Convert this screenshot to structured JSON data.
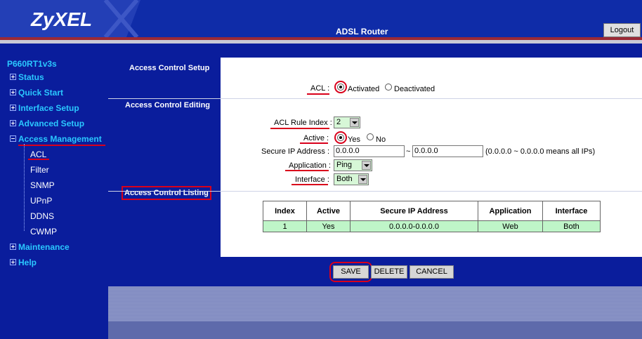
{
  "header": {
    "logo": "ZyXEL",
    "title": "ADSL Router",
    "logout_label": "Logout"
  },
  "sidebar": {
    "model": "P660RT1v3s",
    "items": [
      {
        "label": "Status",
        "expanded": false
      },
      {
        "label": "Quick Start",
        "expanded": false
      },
      {
        "label": "Interface Setup",
        "expanded": false
      },
      {
        "label": "Advanced Setup",
        "expanded": false
      },
      {
        "label": "Access Management",
        "expanded": true
      },
      {
        "label": "Maintenance",
        "expanded": false
      },
      {
        "label": "Help",
        "expanded": false
      }
    ],
    "sub_items": [
      "ACL",
      "Filter",
      "SNMP",
      "UPnP",
      "DDNS",
      "CWMP"
    ]
  },
  "sections": {
    "setup": "Access Control Setup",
    "editing": "Access Control Editing",
    "listing": "Access Control Listing"
  },
  "form": {
    "acl_label": "ACL",
    "acl_activated": "Activated",
    "acl_deactivated": "Deactivated",
    "rule_index_label": "ACL Rule Index",
    "rule_index_value": "2",
    "active_label": "Active",
    "active_yes": "Yes",
    "active_no": "No",
    "secure_ip_label": "Secure IP Address",
    "secure_ip_from": "0.0.0.0",
    "secure_ip_sep": "~",
    "secure_ip_to": "0.0.0.0",
    "secure_ip_hint": "(0.0.0.0 ~ 0.0.0.0 means all IPs)",
    "application_label": "Application",
    "application_value": "Ping",
    "interface_label": "Interface",
    "interface_value": "Both",
    "colon": ":"
  },
  "table": {
    "headers": [
      "Index",
      "Active",
      "Secure IP Address",
      "Application",
      "Interface"
    ],
    "rows": [
      [
        "1",
        "Yes",
        "0.0.0.0-0.0.0.0",
        "Web",
        "Both"
      ]
    ]
  },
  "buttons": {
    "save": "SAVE",
    "delete": "DELETE",
    "cancel": "CANCEL"
  },
  "colors": {
    "background": "#0a1d9c",
    "nav_text": "#2ac8ff",
    "highlight": "#d9001b",
    "table_row": "#bff5c8"
  }
}
